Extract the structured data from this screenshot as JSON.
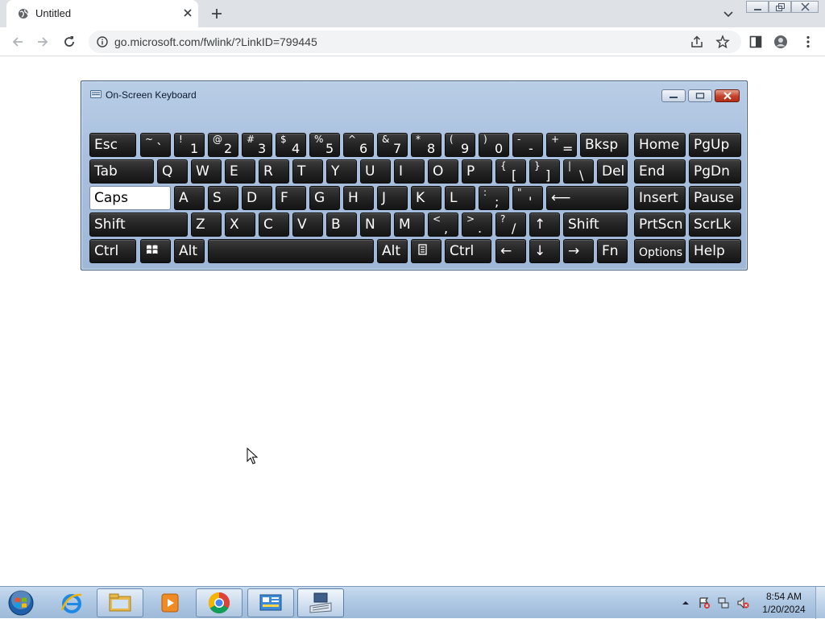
{
  "browser": {
    "tab": {
      "title": "Untitled",
      "favicon": "globe-icon"
    },
    "address": {
      "url": "go.microsoft.com/fwlink/?LinkID=799445"
    }
  },
  "osk": {
    "title": "On-Screen Keyboard",
    "rows": [
      [
        {
          "id": "esc",
          "label": "Esc"
        },
        {
          "id": "tilde",
          "top": "~",
          "bottom": "`"
        },
        {
          "id": "1",
          "top": "!",
          "bottom": "1"
        },
        {
          "id": "2",
          "top": "@",
          "bottom": "2"
        },
        {
          "id": "3",
          "top": "#",
          "bottom": "3"
        },
        {
          "id": "4",
          "top": "$",
          "bottom": "4"
        },
        {
          "id": "5",
          "top": "%",
          "bottom": "5"
        },
        {
          "id": "6",
          "top": "^",
          "bottom": "6"
        },
        {
          "id": "7",
          "top": "&",
          "bottom": "7"
        },
        {
          "id": "8",
          "top": "*",
          "bottom": "8"
        },
        {
          "id": "9",
          "top": "(",
          "bottom": "9"
        },
        {
          "id": "0",
          "top": ")",
          "bottom": "0"
        },
        {
          "id": "minus",
          "top": "-",
          "bottom": "-"
        },
        {
          "id": "equals",
          "top": "+",
          "bottom": "="
        },
        {
          "id": "bksp",
          "label": "Bksp"
        },
        {
          "id": "home",
          "label": "Home"
        },
        {
          "id": "pgup",
          "label": "PgUp"
        }
      ],
      [
        {
          "id": "tab",
          "label": "Tab"
        },
        {
          "id": "q",
          "label": "Q"
        },
        {
          "id": "w",
          "label": "W"
        },
        {
          "id": "e",
          "label": "E"
        },
        {
          "id": "r",
          "label": "R"
        },
        {
          "id": "t",
          "label": "T"
        },
        {
          "id": "y",
          "label": "Y"
        },
        {
          "id": "u",
          "label": "U"
        },
        {
          "id": "i",
          "label": "I"
        },
        {
          "id": "o",
          "label": "O"
        },
        {
          "id": "p",
          "label": "P"
        },
        {
          "id": "lbracket",
          "top": "{",
          "bottom": "["
        },
        {
          "id": "rbracket",
          "top": "}",
          "bottom": "]"
        },
        {
          "id": "backslash",
          "top": "|",
          "bottom": "\\"
        },
        {
          "id": "del",
          "label": "Del"
        },
        {
          "id": "end",
          "label": "End"
        },
        {
          "id": "pgdn",
          "label": "PgDn"
        }
      ],
      [
        {
          "id": "caps",
          "label": "Caps",
          "lit": true
        },
        {
          "id": "a",
          "label": "A"
        },
        {
          "id": "s",
          "label": "S"
        },
        {
          "id": "d",
          "label": "D"
        },
        {
          "id": "f",
          "label": "F"
        },
        {
          "id": "g",
          "label": "G"
        },
        {
          "id": "h",
          "label": "H"
        },
        {
          "id": "j",
          "label": "J"
        },
        {
          "id": "k",
          "label": "K"
        },
        {
          "id": "l",
          "label": "L"
        },
        {
          "id": "semicolon",
          "top": ":",
          "bottom": ";"
        },
        {
          "id": "quote",
          "top": "\"",
          "bottom": "'"
        },
        {
          "id": "enter",
          "label": "⟵"
        },
        {
          "id": "insert",
          "label": "Insert"
        },
        {
          "id": "pause",
          "label": "Pause"
        }
      ],
      [
        {
          "id": "lshift",
          "label": "Shift"
        },
        {
          "id": "z",
          "label": "Z"
        },
        {
          "id": "x",
          "label": "X"
        },
        {
          "id": "c",
          "label": "C"
        },
        {
          "id": "v",
          "label": "V"
        },
        {
          "id": "b",
          "label": "B"
        },
        {
          "id": "n",
          "label": "N"
        },
        {
          "id": "m",
          "label": "M"
        },
        {
          "id": "comma",
          "top": "<",
          "bottom": ","
        },
        {
          "id": "period",
          "top": ">",
          "bottom": "."
        },
        {
          "id": "slash",
          "top": "?",
          "bottom": "/"
        },
        {
          "id": "up",
          "label": "↑"
        },
        {
          "id": "rshift",
          "label": "Shift"
        },
        {
          "id": "prtscn",
          "label": "PrtScn"
        },
        {
          "id": "scrlk",
          "label": "ScrLk"
        }
      ],
      [
        {
          "id": "lctrl",
          "label": "Ctrl"
        },
        {
          "id": "win",
          "icon": "windows-logo-icon"
        },
        {
          "id": "lalt",
          "label": "Alt"
        },
        {
          "id": "space",
          "label": ""
        },
        {
          "id": "ralt",
          "label": "Alt"
        },
        {
          "id": "menu",
          "icon": "context-menu-icon"
        },
        {
          "id": "rctrl",
          "label": "Ctrl"
        },
        {
          "id": "left",
          "label": "←"
        },
        {
          "id": "down",
          "label": "↓"
        },
        {
          "id": "right",
          "label": "→"
        },
        {
          "id": "fn",
          "label": "Fn"
        },
        {
          "id": "options",
          "label": "Options"
        },
        {
          "id": "help",
          "label": "Help"
        }
      ]
    ]
  },
  "taskbar": {
    "items": [
      {
        "id": "ie",
        "icon": "internet-explorer-icon"
      },
      {
        "id": "explorer",
        "icon": "folder-icon"
      },
      {
        "id": "media",
        "icon": "media-player-icon"
      },
      {
        "id": "chrome",
        "icon": "chrome-icon"
      },
      {
        "id": "control",
        "icon": "control-panel-icon"
      },
      {
        "id": "osk",
        "icon": "on-screen-keyboard-icon"
      }
    ],
    "tray": [
      "show-hidden-icons-icon",
      "action-center-icon",
      "network-icon",
      "volume-muted-icon"
    ],
    "clock": {
      "time": "8:54 AM",
      "date": "1/20/2024"
    }
  }
}
